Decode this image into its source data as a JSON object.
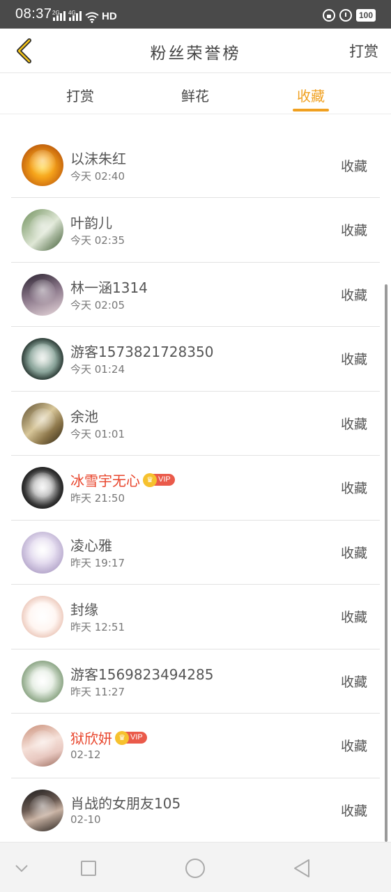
{
  "status_bar": {
    "time": "08:37",
    "network_1": "2G",
    "network_2": "4G",
    "hd_label": "HD",
    "battery": "100",
    "icons": [
      "signal-icon",
      "wifi-icon",
      "hd-icon",
      "lock-rotation-icon",
      "alarm-icon",
      "battery-icon"
    ]
  },
  "header": {
    "title": "粉丝荣誉榜",
    "action": "打赏",
    "back_icon": "chevron-left-icon",
    "accent_color": "#f0a020"
  },
  "tabs": [
    {
      "label": "打赏",
      "active": false
    },
    {
      "label": "鲜花",
      "active": false
    },
    {
      "label": "收藏",
      "active": true
    }
  ],
  "list": [
    {
      "name": "以沫朱红",
      "time": "今天 02:40",
      "action": "收藏",
      "vip": false,
      "vip_label": ""
    },
    {
      "name": "叶韵儿",
      "time": "今天 02:35",
      "action": "收藏",
      "vip": false,
      "vip_label": ""
    },
    {
      "name": "林一涵1314",
      "time": "今天 02:05",
      "action": "收藏",
      "vip": false,
      "vip_label": ""
    },
    {
      "name": "游客1573821728350",
      "time": "今天 01:24",
      "action": "收藏",
      "vip": false,
      "vip_label": ""
    },
    {
      "name": "余池",
      "time": "今天 01:01",
      "action": "收藏",
      "vip": false,
      "vip_label": ""
    },
    {
      "name": "冰雪宇无心",
      "time": "昨天 21:50",
      "action": "收藏",
      "vip": true,
      "vip_label": "VIP"
    },
    {
      "name": "凌心雅",
      "time": "昨天 19:17",
      "action": "收藏",
      "vip": false,
      "vip_label": ""
    },
    {
      "name": "封缘",
      "time": "昨天 12:51",
      "action": "收藏",
      "vip": false,
      "vip_label": ""
    },
    {
      "name": "游客1569823494285",
      "time": "昨天 11:27",
      "action": "收藏",
      "vip": false,
      "vip_label": ""
    },
    {
      "name": "狱欣妍",
      "time": "02-12",
      "action": "收藏",
      "vip": true,
      "vip_label": "VIP"
    },
    {
      "name": "肖战的女朋友105",
      "time": "02-10",
      "action": "收藏",
      "vip": false,
      "vip_label": ""
    }
  ],
  "nav_bar": {
    "icons": [
      "chevron-down-icon",
      "recent-apps-icon",
      "home-icon",
      "back-icon"
    ]
  }
}
